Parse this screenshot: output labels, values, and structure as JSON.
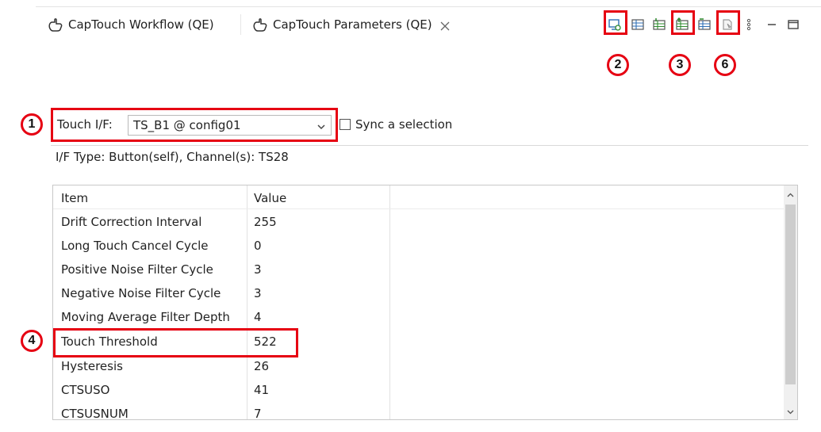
{
  "tabs": [
    {
      "label": "CapTouch Workflow (QE)",
      "icon": "captouch-hand-icon",
      "active": false
    },
    {
      "label": "CapTouch Parameters (QE)",
      "icon": "captouch-hand-icon",
      "active": true
    }
  ],
  "toolbar": {
    "icons": [
      "monitor-icon",
      "table-view-icon",
      "table-import-icon",
      "table-export-icon",
      "table-compare-icon",
      "copy-document-icon",
      "view-menu-icon",
      "minimize-icon",
      "maximize-icon"
    ]
  },
  "annotations": {
    "m1": "1",
    "m2": "2",
    "m3": "3",
    "m4": "4",
    "m6": "6"
  },
  "touch_if": {
    "label": "Touch I/F:",
    "selected": "TS_B1 @ config01",
    "sync_label": "Sync a selection",
    "sync_checked": false,
    "if_type": "I/F Type: Button(self), Channel(s): TS28"
  },
  "table": {
    "headers": {
      "item": "Item",
      "value": "Value"
    },
    "rows": [
      {
        "item": "Drift Correction Interval",
        "value": "255"
      },
      {
        "item": "Long Touch Cancel Cycle",
        "value": "0"
      },
      {
        "item": "Positive Noise Filter Cycle",
        "value": "3"
      },
      {
        "item": "Negative Noise Filter Cycle",
        "value": "3"
      },
      {
        "item": "Moving Average Filter Depth",
        "value": "4"
      },
      {
        "item": "Touch Threshold",
        "value": "522"
      },
      {
        "item": "Hysteresis",
        "value": "26"
      },
      {
        "item": "CTSUSO",
        "value": "41"
      },
      {
        "item": "CTSUSNUM",
        "value": "7"
      }
    ]
  },
  "colors": {
    "annotation": "#e60012",
    "icon_green": "#2e8b2e",
    "icon_blue": "#2f6fb5"
  }
}
